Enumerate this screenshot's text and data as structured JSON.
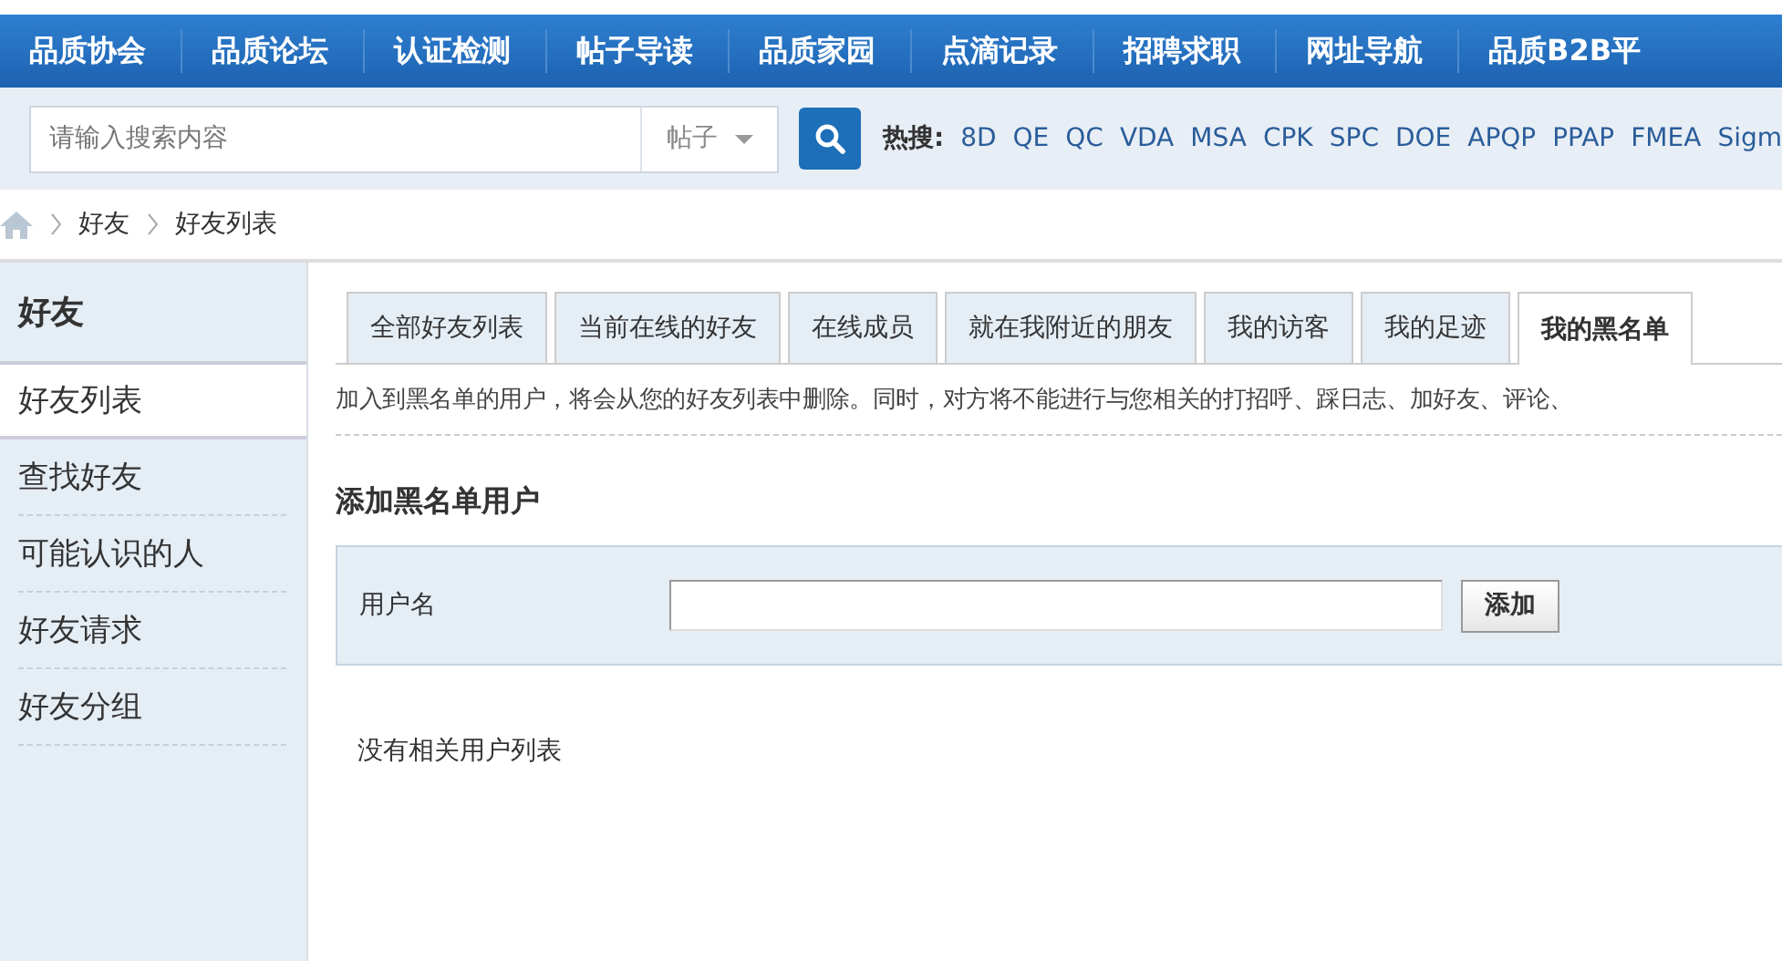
{
  "nav": {
    "items": [
      "品质协会",
      "品质论坛",
      "认证检测",
      "帖子导读",
      "品质家园",
      "点滴记录",
      "招聘求职",
      "网址导航",
      "品质B2B平"
    ]
  },
  "search": {
    "placeholder": "请输入搜索内容",
    "scope": "帖子",
    "hot_label": "热搜:",
    "hot_terms": [
      "8D",
      "QE",
      "QC",
      "VDA",
      "MSA",
      "CPK",
      "SPC",
      "DOE",
      "APQP",
      "PPAP",
      "FMEA",
      "Sigm"
    ]
  },
  "breadcrumb": [
    "好友",
    "好友列表"
  ],
  "sidebar": {
    "title": "好友",
    "items": [
      {
        "label": "好友列表",
        "selected": true
      },
      {
        "label": "查找好友",
        "selected": false
      },
      {
        "label": "可能认识的人",
        "selected": false
      },
      {
        "label": "好友请求",
        "selected": false
      },
      {
        "label": "好友分组",
        "selected": false
      }
    ]
  },
  "tabs": [
    {
      "label": "全部好友列表",
      "selected": false
    },
    {
      "label": "当前在线的好友",
      "selected": false
    },
    {
      "label": "在线成员",
      "selected": false
    },
    {
      "label": "就在我附近的朋友",
      "selected": false
    },
    {
      "label": "我的访客",
      "selected": false
    },
    {
      "label": "我的足迹",
      "selected": false
    },
    {
      "label": "我的黑名单",
      "selected": true
    }
  ],
  "notice": "加入到黑名单的用户，将会从您的好友列表中删除。同时，对方将不能进行与您相关的打招呼、踩日志、加好友、评论、",
  "add_form": {
    "heading": "添加黑名单用户",
    "field_label": "用户名",
    "button": "添加"
  },
  "empty_message": "没有相关用户列表"
}
